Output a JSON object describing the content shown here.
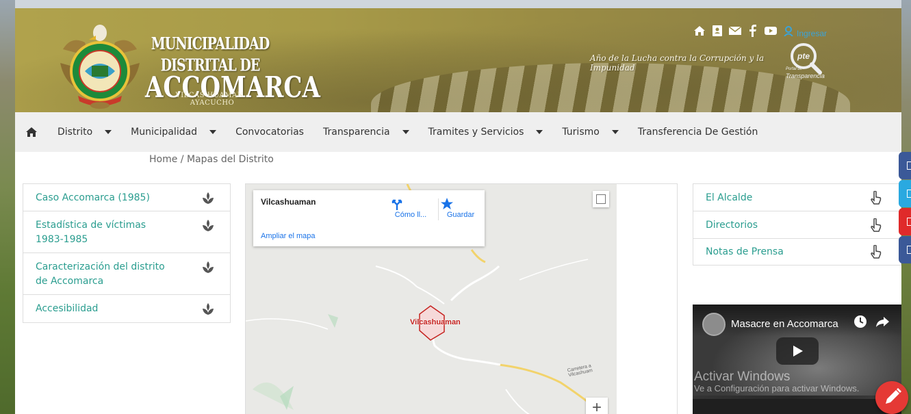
{
  "header": {
    "title_line1": "MUNICIPALIDAD DISTRITAL DE",
    "title_line2": "ACCOMARCA",
    "subtitle": "VILCAS HUAMAN - AYACUCHO",
    "motto": "Año de la Lucha contra la Corrupción y la Impunidad",
    "login_label": "Ingresar",
    "transparency_portal_abbrev": "pte",
    "transparency_portal_label1": "Portal de",
    "transparency_portal_label2": "Transparencia",
    "top_icons": [
      "home-icon",
      "contact-book-icon",
      "mail-icon",
      "facebook-icon",
      "youtube-icon",
      "user-icon"
    ]
  },
  "nav": {
    "home_icon": "home-icon",
    "items": [
      {
        "label": "Distrito",
        "dropdown": true
      },
      {
        "label": "Municipalidad",
        "dropdown": true
      },
      {
        "label": "Convocatorias",
        "dropdown": false
      },
      {
        "label": "Transparencia",
        "dropdown": true
      },
      {
        "label": "Tramites y Servicios",
        "dropdown": true
      },
      {
        "label": "Turismo",
        "dropdown": true
      },
      {
        "label": "Transferencia De Gestión",
        "dropdown": false
      }
    ]
  },
  "breadcrumb": {
    "home": "Home",
    "separator": " / ",
    "current": "Mapas del Distrito"
  },
  "left_menu": {
    "items": [
      {
        "label": "Caso Accomarca (1985)",
        "icon": "sprout-icon"
      },
      {
        "label": "Estadística de víctimas 1983-1985",
        "icon": "sprout-icon"
      },
      {
        "label": "Caracterización del distrito de Accomarca",
        "icon": "sprout-icon"
      },
      {
        "label": "Accesibilidad",
        "icon": "sprout-icon"
      }
    ]
  },
  "map": {
    "place_name": "Vilcashuaman",
    "directions_label": "Cómo ll...",
    "save_label": "Guardar",
    "enlarge_label": "Ampliar el mapa",
    "town_label": "Vilcashuaman",
    "road_label": "Carretera a Vilcashuam",
    "zoom_in": "+"
  },
  "right_menu": {
    "items": [
      {
        "label": "El Alcalde",
        "icon": "pointer-hand-icon"
      },
      {
        "label": "Directorios",
        "icon": "pointer-hand-icon"
      },
      {
        "label": "Notas de Prensa",
        "icon": "pointer-hand-icon"
      }
    ]
  },
  "video": {
    "title": "Masacre en Accomarca"
  },
  "watermark": {
    "line1": "Activar Windows",
    "line2": "Ve a Configuración para activar Windows."
  },
  "side_tabs": {
    "colors": [
      "#3b5998",
      "#2aa9e0",
      "#e02a2a",
      "#3b5998"
    ]
  },
  "colors": {
    "link": "#2a9d8f",
    "nav_bg": "#efefef",
    "fab": "#e53935",
    "map_link": "#1a73e8",
    "town": "#c5221f"
  }
}
